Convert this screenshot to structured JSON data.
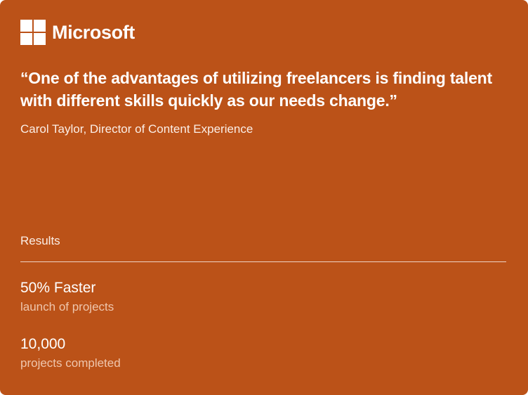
{
  "colors": {
    "card_background": "#bb5218",
    "text_primary": "#ffffff",
    "text_muted": "#efc6ad"
  },
  "logo": {
    "icon": "microsoft-logo-icon",
    "wordmark": "Microsoft"
  },
  "testimonial": {
    "quote": "“One of the advantages of utilizing freelancers is finding talent with different skills quickly as our needs change.”",
    "attribution": "Carol Taylor, Director of Content Experience"
  },
  "results": {
    "label": "Results",
    "metrics": [
      {
        "value": "50% Faster",
        "caption": "launch of projects"
      },
      {
        "value": "10,000",
        "caption": "projects completed"
      }
    ]
  }
}
